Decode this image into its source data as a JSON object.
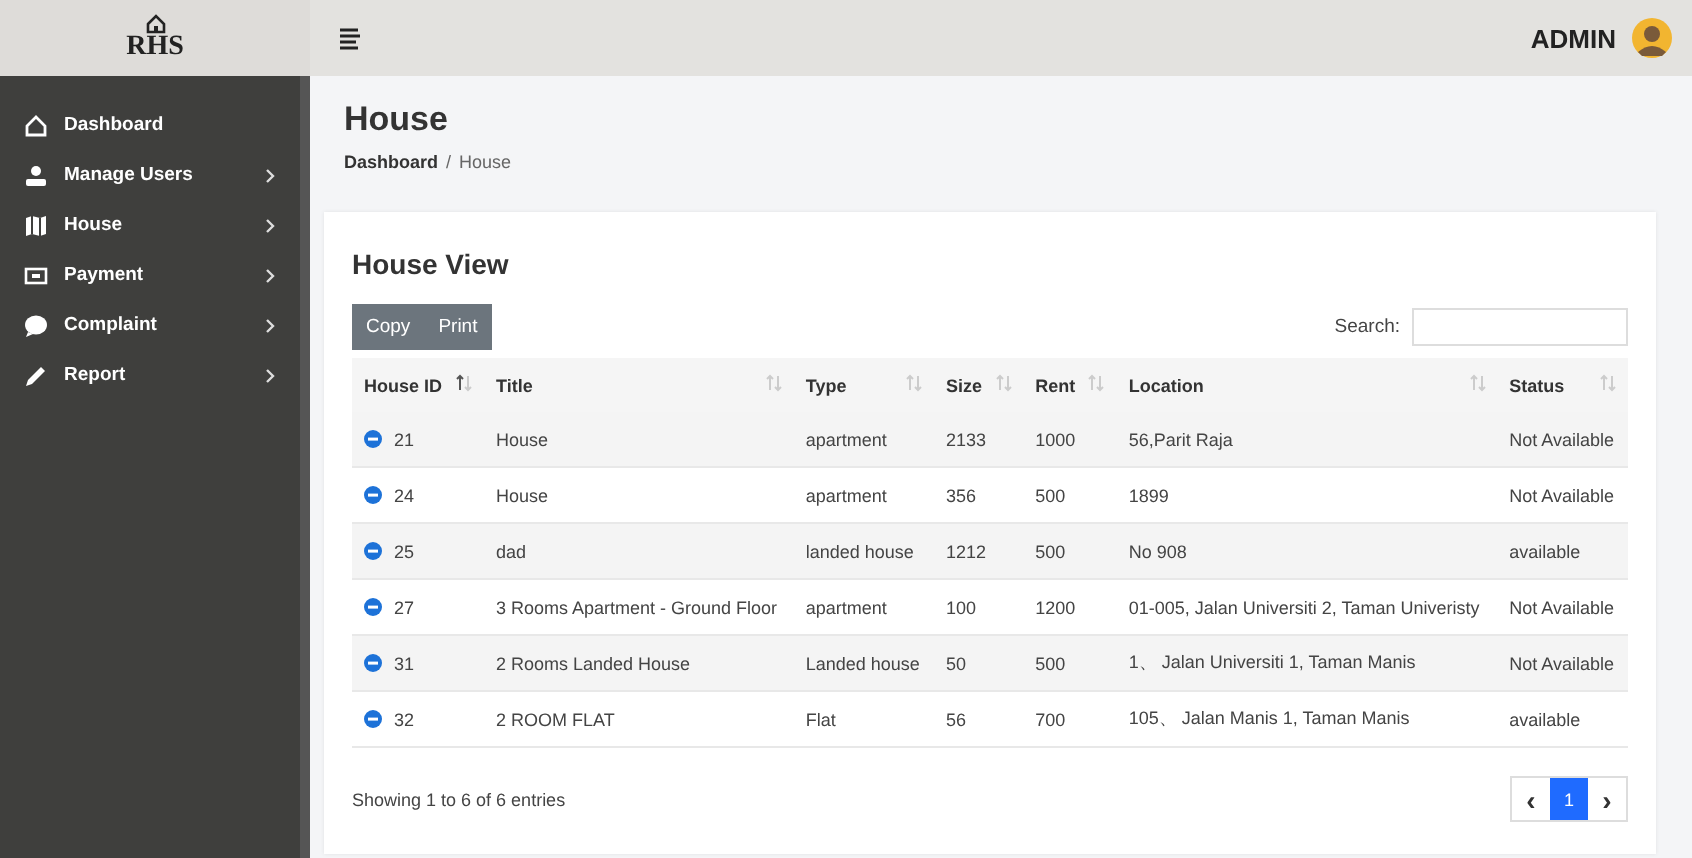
{
  "brand": {
    "name": "RHS"
  },
  "header": {
    "user": "ADMIN"
  },
  "sidebar": {
    "items": [
      {
        "label": "Dashboard",
        "expandable": false
      },
      {
        "label": "Manage Users",
        "expandable": true
      },
      {
        "label": "House",
        "expandable": true
      },
      {
        "label": "Payment",
        "expandable": true
      },
      {
        "label": "Complaint",
        "expandable": true
      },
      {
        "label": "Report",
        "expandable": true
      }
    ]
  },
  "page": {
    "title": "House",
    "breadcrumb_separator": "/",
    "breadcrumb": [
      {
        "label": "Dashboard",
        "link": true
      },
      {
        "label": "House",
        "link": false
      }
    ]
  },
  "card": {
    "title": "House View",
    "buttons": [
      "Copy",
      "Print"
    ],
    "search": {
      "label": "Search:"
    },
    "table": {
      "columns": [
        {
          "label": "House ID",
          "sorted": true
        },
        {
          "label": "Title",
          "sorted": false
        },
        {
          "label": "Type",
          "sorted": false
        },
        {
          "label": "Size",
          "sorted": false
        },
        {
          "label": "Rent",
          "sorted": false
        },
        {
          "label": "Location",
          "sorted": false
        },
        {
          "label": "Status",
          "sorted": false
        }
      ],
      "rows": [
        [
          "21",
          "House",
          "apartment",
          "2133",
          "1000",
          "56,Parit Raja",
          "Not Available"
        ],
        [
          "24",
          "House",
          "apartment",
          "356",
          "500",
          "1899",
          "Not Available"
        ],
        [
          "25",
          "dad",
          "landed house",
          "1212",
          "500",
          "No 908",
          "available"
        ],
        [
          "27",
          "3 Rooms Apartment - Ground Floor",
          "apartment",
          "100",
          "1200",
          "01-005, Jalan Universiti 2, Taman Univeristy",
          "Not Available"
        ],
        [
          "31",
          "2 Rooms Landed House",
          "Landed house",
          "50",
          "500",
          "1、 Jalan Universiti 1, Taman Manis",
          "Not Available"
        ],
        [
          "32",
          "2 ROOM FLAT",
          "Flat",
          "56",
          "700",
          "105、 Jalan Manis 1, Taman Manis",
          "available"
        ]
      ]
    },
    "info": "Showing 1 to 6 of 6 entries",
    "pagination": {
      "prev": "‹",
      "next": "›",
      "pages": [
        {
          "label": "1",
          "selected": true
        }
      ]
    }
  }
}
